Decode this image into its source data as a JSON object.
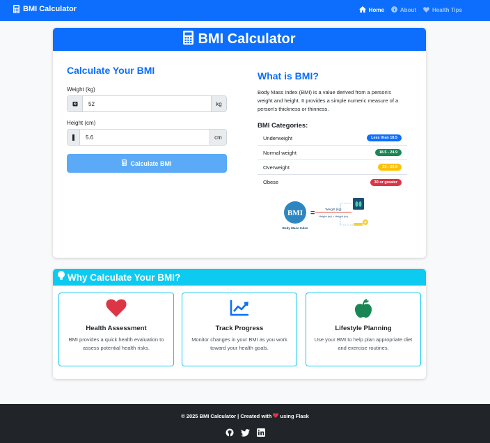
{
  "navbar": {
    "brand": "BMI Calculator",
    "items": [
      {
        "label": "Home",
        "icon": "home-icon",
        "active": true
      },
      {
        "label": "About",
        "icon": "info-circle-icon",
        "active": false
      },
      {
        "label": "Health Tips",
        "icon": "heart-icon",
        "active": false
      }
    ]
  },
  "calculator": {
    "header_title": "BMI Calculator",
    "form_title": "Calculate Your BMI",
    "weight": {
      "label": "Weight (kg)",
      "value": "52",
      "unit": "kg"
    },
    "height": {
      "label": "Height (cm)",
      "value": "5.6",
      "unit": "cm"
    },
    "button_label": "Calculate BMI"
  },
  "info": {
    "title": "What is BMI?",
    "description": "Body Mass Index (BMI) is a value derived from a person's weight and height. It provides a simple numeric measure of a person's thickness or thinness.",
    "categories_title": "BMI Categories:",
    "categories": [
      {
        "name": "Underweight",
        "range": "Less than 18.5",
        "color": "#0d6efd"
      },
      {
        "name": "Normal weight",
        "range": "18.5 - 24.9",
        "color": "#198754"
      },
      {
        "name": "Overweight",
        "range": "25 - 29.9",
        "color": "#ffc107"
      },
      {
        "name": "Obese",
        "range": "30 or greater",
        "color": "#dc3545"
      }
    ],
    "figure": {
      "bmi_text": "BMI",
      "caption": "Body Mass Index",
      "numerator": "Weight (kg)",
      "denominator": "Height (m) × Height (m)"
    }
  },
  "why": {
    "title": "Why Calculate Your BMI?",
    "features": [
      {
        "title": "Health Assessment",
        "description": "BMI provides a quick health evaluation to assess potential health risks.",
        "icon": "heart-icon",
        "color": "#dc3545"
      },
      {
        "title": "Track Progress",
        "description": "Monitor changes in your BMI as you work toward your health goals.",
        "icon": "line-chart-icon",
        "color": "#0d6efd"
      },
      {
        "title": "Lifestyle Planning",
        "description": "Use your BMI to help plan appropriate diet and exercise routines.",
        "icon": "apple-icon",
        "color": "#198754"
      }
    ]
  },
  "footer": {
    "copyright_pre": "© 2025 BMI Calculator | Created with",
    "copyright_post": "using Flask",
    "social": [
      "github-icon",
      "twitter-icon",
      "linkedin-icon"
    ]
  }
}
